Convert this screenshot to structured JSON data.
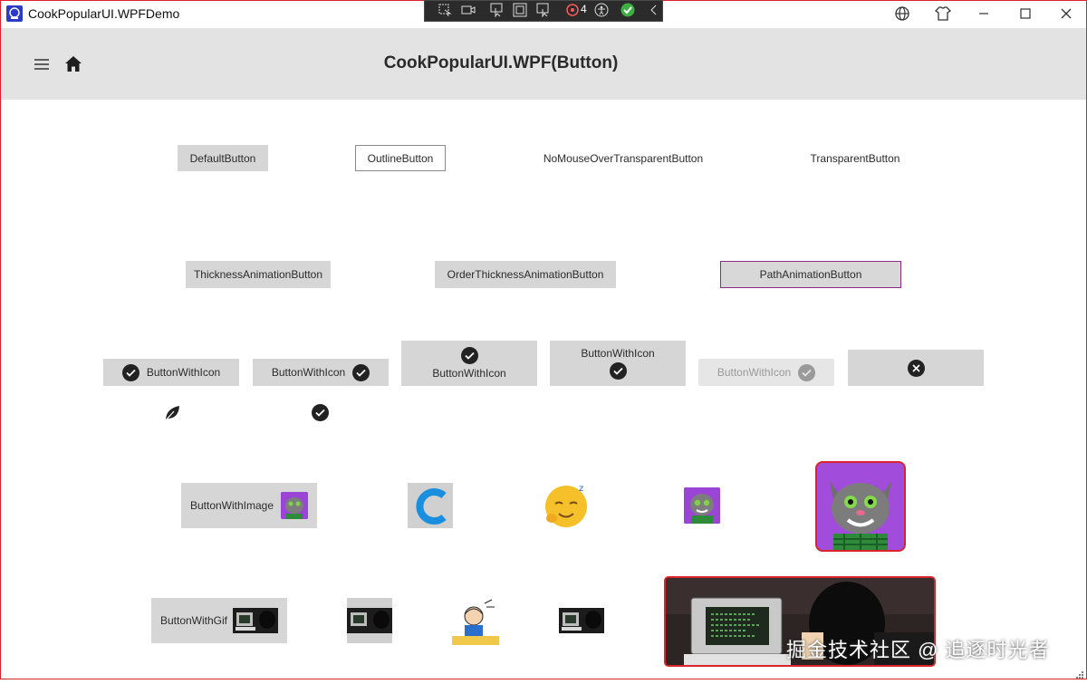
{
  "window": {
    "title": "CookPopularUI.WPFDemo",
    "devtools_count": "4"
  },
  "header": {
    "title": "CookPopularUI.WPF(Button)"
  },
  "row1": {
    "default": "DefaultButton",
    "outline": "OutlineButton",
    "nomouseover": "NoMouseOverTransparentButton",
    "transparent": "TransparentButton"
  },
  "row2": {
    "thickness": "ThicknessAnimationButton",
    "order": "OrderThicknessAnimationButton",
    "path": "PathAnimationButton"
  },
  "row3": {
    "icon_left": "ButtonWithIcon",
    "icon_right": "ButtonWithIcon",
    "icon_top": "ButtonWithIcon",
    "icon_bottom": "ButtonWithIcon",
    "icon_disabled": "ButtonWithIcon"
  },
  "row4": {
    "image": "ButtonWithImage"
  },
  "row5": {
    "gif": "ButtonWithGif"
  },
  "watermark": "掘金技术社区 @ 追逐时光者",
  "colors": {
    "frame_border": "#d9242c",
    "header_bg": "#e3e3e3",
    "button_gray": "#d6d6d6",
    "path_border": "#8b2a8b",
    "tom_bg": "#8e3fd3"
  }
}
